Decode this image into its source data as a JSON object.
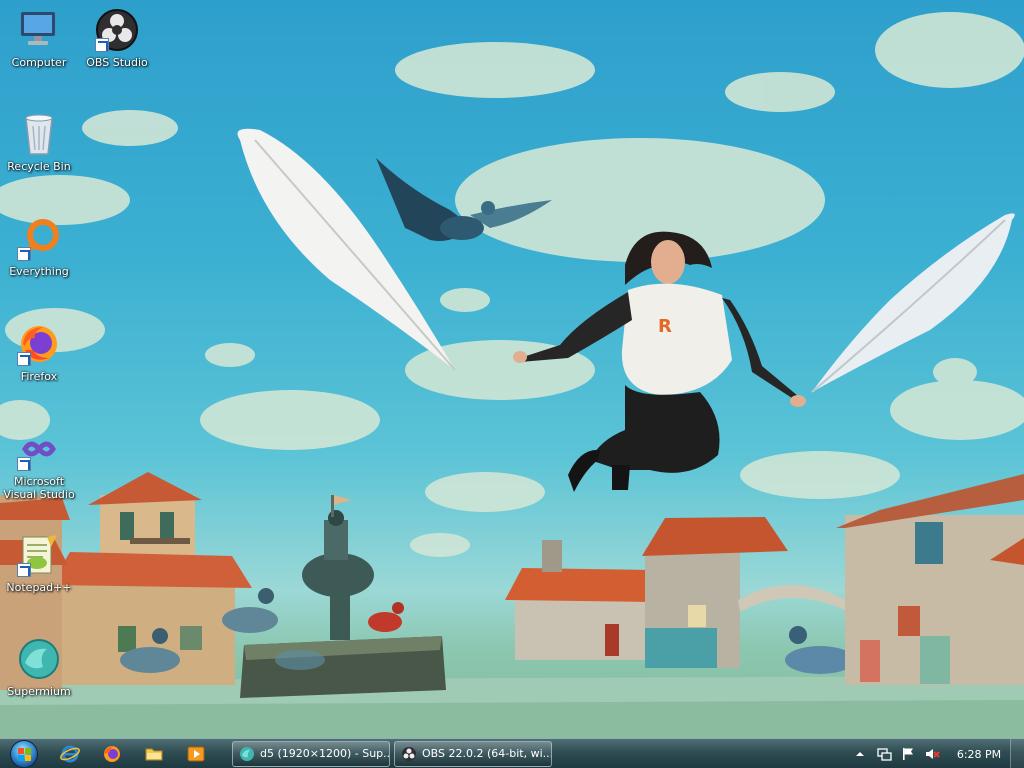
{
  "desktop": {
    "icons": [
      {
        "label": "Computer",
        "icon": "computer-icon",
        "shortcut": false
      },
      {
        "label": "OBS Studio",
        "icon": "obs-studio-icon",
        "shortcut": true
      },
      {
        "label": "Recycle Bin",
        "icon": "recycle-bin-icon",
        "shortcut": false
      },
      {
        "label": "Everything",
        "icon": "everything-search-icon",
        "shortcut": true
      },
      {
        "label": "Firefox",
        "icon": "firefox-icon",
        "shortcut": true
      },
      {
        "label": "Microsoft Visual Studio",
        "icon": "visual-studio-icon",
        "shortcut": true
      },
      {
        "label": "Notepad++",
        "icon": "notepad-plus-plus-icon",
        "shortcut": true
      },
      {
        "label": "Supermium",
        "icon": "supermium-icon",
        "shortcut": false
      }
    ],
    "wallpaper": {
      "shirt_text": "R",
      "sky_color": "#36a8cf",
      "roof_color": "#d2603a"
    }
  },
  "taskbar": {
    "start_icon": "windows-start-orb-icon",
    "quick_launch": [
      {
        "name": "internet-explorer-icon"
      },
      {
        "name": "firefox-icon"
      },
      {
        "name": "file-explorer-icon"
      },
      {
        "name": "media-player-icon"
      }
    ],
    "windows": [
      {
        "label": "d5 (1920×1200) - Sup...",
        "icon": "supermium-icon"
      },
      {
        "label": "OBS 22.0.2 (64-bit, wi...",
        "icon": "obs-studio-icon"
      }
    ],
    "tray": {
      "icons": [
        "show-hidden-icons-chevron",
        "network-icon",
        "action-center-flag-icon",
        "volume-muted-icon"
      ],
      "time": "6:28 PM"
    }
  }
}
